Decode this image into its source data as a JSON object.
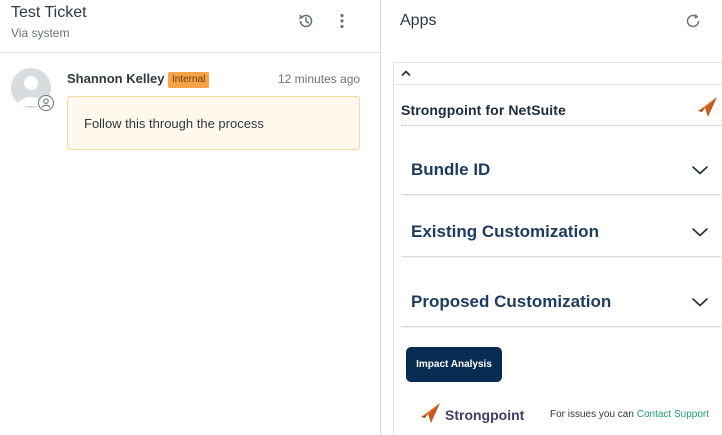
{
  "ticket": {
    "title": "Test Ticket",
    "subtitle": "Via system"
  },
  "comment": {
    "author": "Shannon Kelley",
    "badge": "Internal",
    "timestamp": "12 minutes ago",
    "body": "Follow this through the process"
  },
  "apps": {
    "title": "Apps",
    "app_name": "Strongpoint for NetSuite",
    "accordions": [
      {
        "label": "Bundle ID"
      },
      {
        "label": "Existing Customization"
      },
      {
        "label": "Proposed Customization"
      }
    ],
    "impact_button": "Impact Analysis",
    "brand": "Strongpoint",
    "support_prefix": "For issues you can ",
    "support_link": "Contact Support"
  },
  "colors": {
    "badge_bg": "#f6a347",
    "comment_bg": "#fff8ed",
    "button_bg": "#082b52",
    "accordion_text": "#1d3a5f",
    "link": "#1f9e6f",
    "logo_orange": "#e8742c"
  },
  "icons": {
    "history": "history-icon",
    "menu": "kebab-menu-icon",
    "refresh": "refresh-icon",
    "collapse": "chevron-up-icon",
    "accordion": "chevron-down-icon",
    "logo": "strongpoint-logo"
  }
}
